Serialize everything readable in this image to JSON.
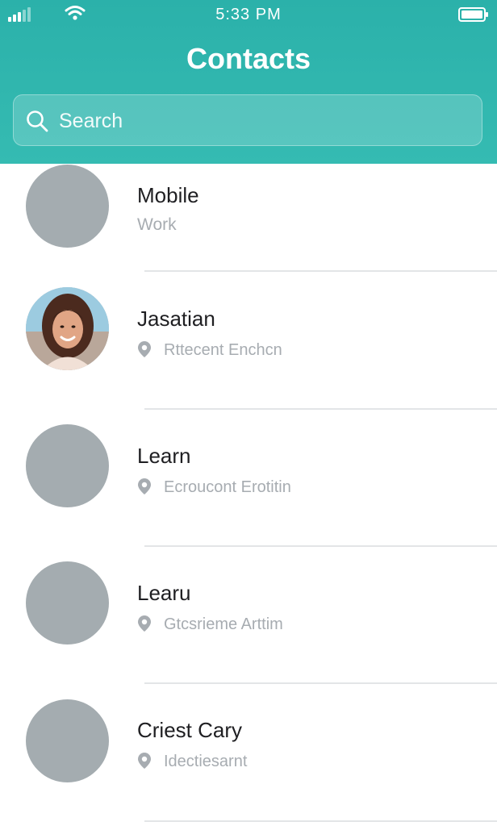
{
  "status_bar": {
    "time": "5:33 PM"
  },
  "header": {
    "title": "Contacts"
  },
  "search": {
    "placeholder": "Search"
  },
  "contacts": [
    {
      "name": "Mobile",
      "subtitle": "Work",
      "has_photo": false
    },
    {
      "name": "Jasatian",
      "location": "Rttecent Enchcn",
      "has_photo": true
    },
    {
      "name": "Learn",
      "location": "Ecroucont Erotitin",
      "has_photo": false
    },
    {
      "name": "Learu",
      "location": "Gtcsrieme Arttim",
      "has_photo": false
    },
    {
      "name": "Criest Cary",
      "location": "Idectiesarnt",
      "has_photo": false
    }
  ],
  "colors": {
    "header": "#2bb1aa",
    "avatar_placeholder": "#a4acb0",
    "divider": "#e3e5e7",
    "secondary_text": "#a7acb1"
  },
  "icons": [
    "signal-icon",
    "wifi-icon",
    "battery-icon",
    "search-icon",
    "location-pin-icon"
  ]
}
